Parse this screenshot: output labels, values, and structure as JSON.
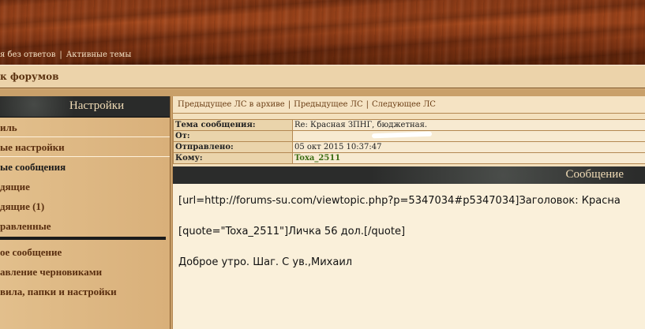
{
  "header": {
    "top_links": [
      "я без ответов",
      "Активные темы"
    ],
    "breadcrumb": "к форумов"
  },
  "sidebar": {
    "title": "Настройки",
    "items": [
      {
        "label": "иль"
      },
      {
        "label": "ые настройки"
      },
      {
        "label": "ые сообщения",
        "current": true
      },
      {
        "label": "дящие"
      },
      {
        "label": "дящие (1)"
      },
      {
        "label": "равленные"
      },
      {
        "label": "ое сообщение"
      },
      {
        "label": "авление черновиками"
      },
      {
        "label": "вила, папки и настройки"
      }
    ]
  },
  "main": {
    "nav": {
      "prev_archive": "Предыдущее ЛС в архиве",
      "prev": "Предыдущее ЛС",
      "next": "Следующее ЛС"
    },
    "fields": {
      "subject_label": "Тема сообщения:",
      "subject_value": "Re: Красная ЗПНГ, бюджетная.",
      "from_label": "От:",
      "from_value": "",
      "sent_label": "Отправлено:",
      "sent_value": "05 окт 2015 10:37:47",
      "to_label": "Кому:",
      "to_value": "Toxa_2511"
    },
    "message_title": "Сообщение",
    "message_lines": [
      "[url=http://forums-su.com/viewtopic.php?p=5347034#p5347034]Заголовок: Красна",
      "[quote=\"Toxa_2511\"]Личка 56 дол.[/quote]",
      "Доброе утро. Шаг. С ув.,Михаил"
    ]
  },
  "colors": {
    "wood": "#8a3a16",
    "panel": "#f3e0bd",
    "sidebar": "#d9b07a",
    "link": "#6b3d14",
    "username": "#3b6d14",
    "dark_header": "#2b2d2c"
  }
}
